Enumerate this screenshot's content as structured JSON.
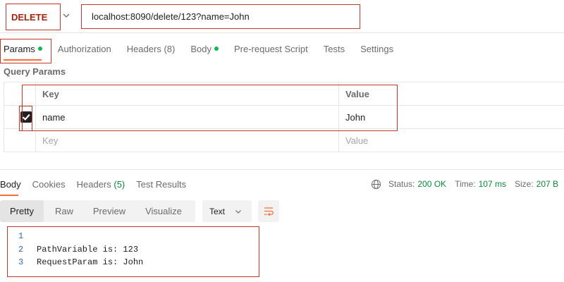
{
  "request": {
    "method": "DELETE",
    "url": "localhost:8090/delete/123?name=John"
  },
  "request_tabs": [
    {
      "label": "Params",
      "dot": true
    },
    {
      "label": "Authorization"
    },
    {
      "label": "Headers",
      "count": "(8)"
    },
    {
      "label": "Body",
      "dot": true
    },
    {
      "label": "Pre-request Script"
    },
    {
      "label": "Tests"
    },
    {
      "label": "Settings"
    }
  ],
  "query_params": {
    "title": "Query Params",
    "columns": {
      "key": "Key",
      "value": "Value"
    },
    "rows": [
      {
        "key": "name",
        "value": "John",
        "checked": true
      }
    ],
    "placeholder": {
      "key": "Key",
      "value": "Value"
    }
  },
  "response_tabs": {
    "body": "Body",
    "cookies": "Cookies",
    "headers": "Headers",
    "headers_count": "(5)",
    "test_results": "Test Results"
  },
  "status": {
    "status_label": "Status:",
    "status_value": "200 OK",
    "time_label": "Time:",
    "time_value": "107 ms",
    "size_label": "Size:",
    "size_value": "207 B"
  },
  "view_modes": [
    "Pretty",
    "Raw",
    "Preview",
    "Visualize"
  ],
  "format": "Text",
  "response_body": [
    {
      "n": "1",
      "text": ""
    },
    {
      "n": "2",
      "text": "PathVariable is: 123"
    },
    {
      "n": "3",
      "text": "RequestParam is: John"
    }
  ],
  "colors": {
    "accent": "#ff6c37",
    "method": "#a1260d",
    "success": "#0b8a3b",
    "annotation": "#c0392b"
  }
}
